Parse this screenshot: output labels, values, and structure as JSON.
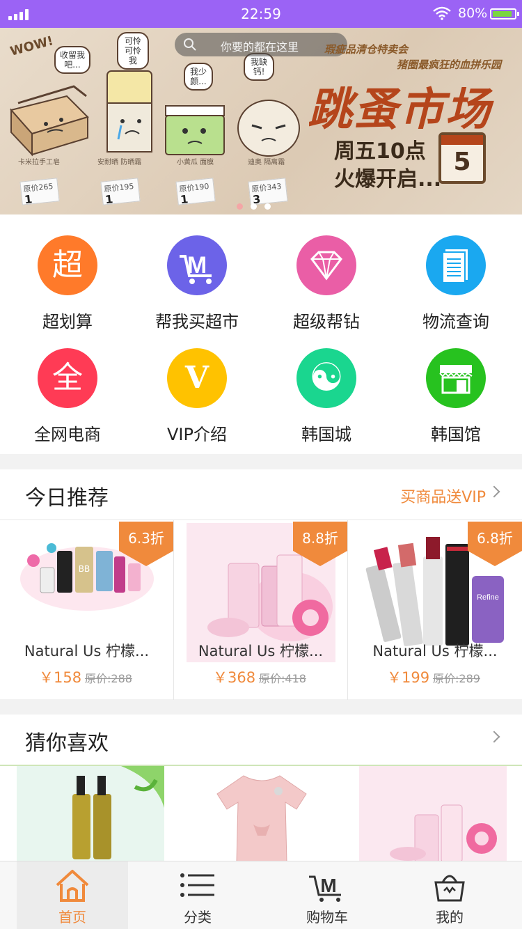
{
  "status_bar": {
    "time": "22:59",
    "battery": "80%"
  },
  "banner": {
    "search_placeholder": "你要的都在这里",
    "tag_top": "瑕疵品清仓特卖会",
    "tag_sub": "猪圈最疯狂的血拼乐园",
    "headline": "跳蚤市场",
    "line1": "周五10点",
    "line2": "火爆开启...",
    "calendar_day": "5",
    "wow": "WOW!",
    "bubbles": [
      "收留我吧...",
      "可怜可怜我",
      "我少颜...",
      "我缺钙!"
    ],
    "products": [
      {
        "label": "卡米拉手工皂",
        "tag": "原价265",
        "price": "1"
      },
      {
        "label": "安耐晒 防晒霜",
        "tag": "原价195",
        "price": "1"
      },
      {
        "label": "小黄瓜 面膜",
        "tag": "原价190",
        "price": "1"
      },
      {
        "label": "迪奥 隔离霜",
        "tag": "原价343",
        "price": "3"
      }
    ],
    "page_count": 3,
    "active_page": 1
  },
  "categories": [
    {
      "label": "超划算",
      "glyph": "超",
      "icon": "chao-icon",
      "color": "#ff7a2a"
    },
    {
      "label": "帮我买超市",
      "glyph": "M",
      "icon": "supermarket-cart-icon",
      "color": "#6c63e8"
    },
    {
      "label": "超级帮钻",
      "glyph": "◆",
      "icon": "diamond-icon",
      "color": "#ea5ea6"
    },
    {
      "label": "物流查询",
      "glyph": "≡",
      "icon": "document-icon",
      "color": "#1aa8f0"
    },
    {
      "label": "全网电商",
      "glyph": "全",
      "icon": "quan-icon",
      "color": "#ff3b55"
    },
    {
      "label": "VIP介绍",
      "glyph": "V",
      "icon": "vip-icon",
      "color": "#ffc200"
    },
    {
      "label": "韩国城",
      "glyph": "☯",
      "icon": "yin-yang-icon",
      "color": "#1ad68f"
    },
    {
      "label": "韩国馆",
      "glyph": "⌂",
      "icon": "storefront-icon",
      "color": "#27c21f"
    }
  ],
  "recommend": {
    "title": "今日推荐",
    "more": "买商品送VIP",
    "items": [
      {
        "discount": "6.3折",
        "name": "Natural Us 柠檬...",
        "price": "￥158",
        "original": "原价:288"
      },
      {
        "discount": "8.8折",
        "name": "Natural Us 柠檬...",
        "price": "￥368",
        "original": "原价:418"
      },
      {
        "discount": "6.8折",
        "name": "Natural Us 柠檬...",
        "price": "￥199",
        "original": "原价:289"
      }
    ]
  },
  "guess": {
    "title": "猜你喜欢"
  },
  "tabbar": {
    "tabs": [
      {
        "label": "首页",
        "icon": "home-icon",
        "active": true
      },
      {
        "label": "分类",
        "icon": "list-icon",
        "active": false
      },
      {
        "label": "购物车",
        "icon": "cart-icon",
        "active": false
      },
      {
        "label": "我的",
        "icon": "bag-icon",
        "active": false
      }
    ]
  },
  "colors": {
    "accent": "#f08a3c",
    "status_bar": "#9b63f5"
  }
}
